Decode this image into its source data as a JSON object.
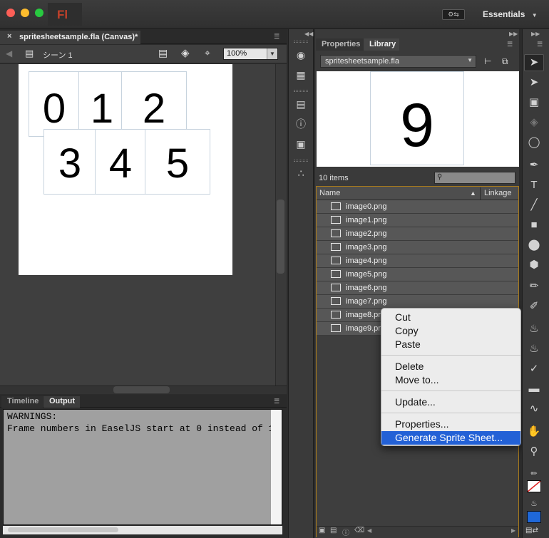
{
  "window": {
    "app_logo": "Fl",
    "workspace_icon": "⚙⇆",
    "workspace_label": "Essentials"
  },
  "document": {
    "tab_title": "spritesheetsample.fla (Canvas)*",
    "tab_close": "×",
    "scene_label": "シーン 1",
    "zoom": "100%",
    "stage_digits": [
      "0",
      "1",
      "2",
      "3",
      "4",
      "5"
    ]
  },
  "bottom_panel": {
    "tabs": [
      "Timeline",
      "Output"
    ],
    "active_tab": "Output",
    "output_lines": [
      "WARNINGS:",
      "Frame numbers in EaselJS start at 0 instead of 1"
    ]
  },
  "library_panel": {
    "tabs": [
      "Properties",
      "Library"
    ],
    "active_tab": "Library",
    "file_select": "spritesheetsample.fla",
    "preview_digit": "9",
    "item_count": "10 items",
    "columns": {
      "name": "Name",
      "linkage": "Linkage"
    },
    "items": [
      "image0.png",
      "image1.png",
      "image2.png",
      "image3.png",
      "image4.png",
      "image5.png",
      "image6.png",
      "image7.png",
      "image8.png",
      "image9.png"
    ]
  },
  "context_menu": {
    "items": [
      "Cut",
      "Copy",
      "Paste",
      "Delete",
      "Move to...",
      "Update...",
      "Properties...",
      "Generate Sprite Sheet..."
    ],
    "highlighted": "Generate Sprite Sheet..."
  },
  "colors": {
    "accent_highlight": "#2361d6",
    "library_border": "#a87a1c",
    "fill_color": "#1f68d8",
    "stroke_color": "#ffffff"
  }
}
